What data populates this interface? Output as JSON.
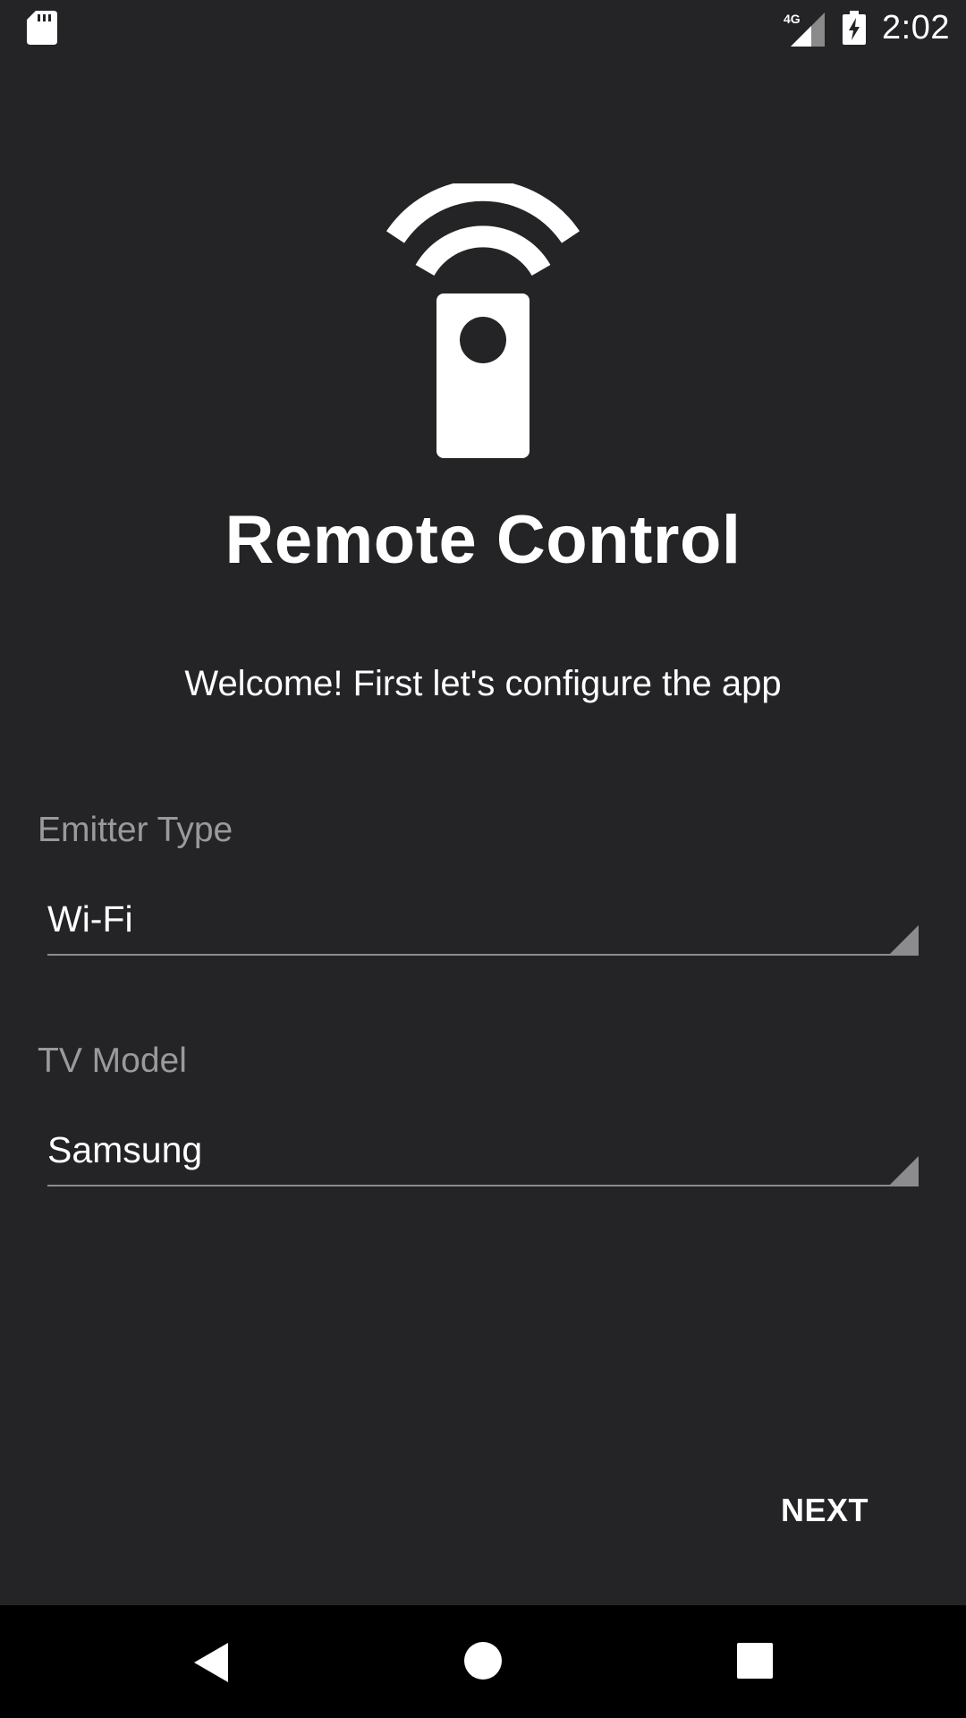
{
  "status_bar": {
    "time": "2:02",
    "network": "4G",
    "icons": [
      "sd-card-icon",
      "signal-4g-icon",
      "battery-charging-icon"
    ]
  },
  "app": {
    "title": "Remote Control",
    "welcome": "Welcome! First let's configure the app",
    "logo_icon": "remote-wifi-icon"
  },
  "form": {
    "emitter_label": "Emitter Type",
    "emitter_value": "Wi-Fi",
    "tv_label": "TV Model",
    "tv_value": "Samsung"
  },
  "actions": {
    "next_label": "NEXT"
  },
  "nav_bar": {
    "icons": [
      "back-icon",
      "home-icon",
      "recents-icon"
    ]
  },
  "colors": {
    "background": "#242427",
    "text": "#ffffff",
    "label": "#9a9a9d",
    "underline": "#8c8c8f",
    "nav_background": "#000000"
  }
}
